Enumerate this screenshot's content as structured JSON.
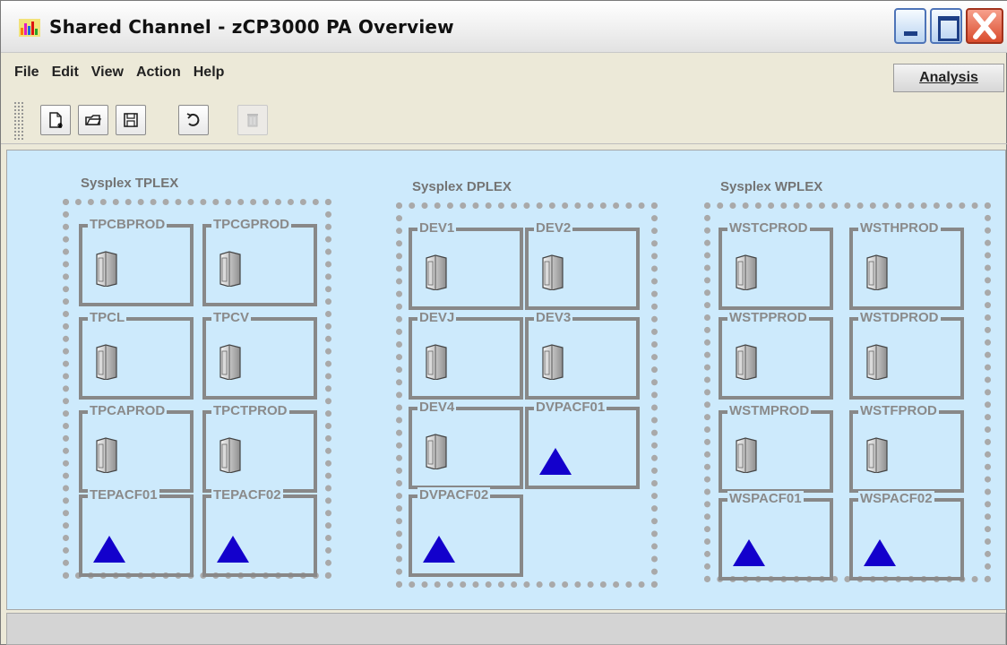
{
  "window": {
    "title": "Shared Channel - zCP3000 PA Overview"
  },
  "menu": {
    "file": "File",
    "edit": "Edit",
    "view": "View",
    "action": "Action",
    "help": "Help",
    "analysis": "Analysis"
  },
  "toolbar": {
    "icons": [
      "new-icon",
      "open-icon",
      "save-icon",
      "refresh-icon",
      "delete-icon"
    ]
  },
  "sysplexes": [
    {
      "label": "Sysplex TPLEX",
      "lpars": [
        {
          "name": "TPCBPROD",
          "type": "server"
        },
        {
          "name": "TPCGPROD",
          "type": "server"
        },
        {
          "name": "TPCL",
          "type": "server"
        },
        {
          "name": "TPCV",
          "type": "server"
        },
        {
          "name": "TPCAPROD",
          "type": "server"
        },
        {
          "name": "TPCTPROD",
          "type": "server"
        },
        {
          "name": "TEPACF01",
          "type": "coupling-facility"
        },
        {
          "name": "TEPACF02",
          "type": "coupling-facility"
        }
      ]
    },
    {
      "label": "Sysplex DPLEX",
      "lpars": [
        {
          "name": "DEV1",
          "type": "server"
        },
        {
          "name": "DEV2",
          "type": "server"
        },
        {
          "name": "DEVJ",
          "type": "server"
        },
        {
          "name": "DEV3",
          "type": "server"
        },
        {
          "name": "DEV4",
          "type": "server"
        },
        {
          "name": "DVPACF01",
          "type": "coupling-facility"
        },
        {
          "name": "DVPACF02",
          "type": "coupling-facility"
        }
      ]
    },
    {
      "label": "Sysplex WPLEX",
      "lpars": [
        {
          "name": "WSTCPROD",
          "type": "server"
        },
        {
          "name": "WSTHPROD",
          "type": "server"
        },
        {
          "name": "WSTPPROD",
          "type": "server"
        },
        {
          "name": "WSTDPROD",
          "type": "server"
        },
        {
          "name": "WSTMPROD",
          "type": "server"
        },
        {
          "name": "WSTFPROD",
          "type": "server"
        },
        {
          "name": "WSPACF01",
          "type": "coupling-facility"
        },
        {
          "name": "WSPACF02",
          "type": "coupling-facility"
        }
      ]
    }
  ],
  "colors": {
    "canvas_background": "#cdeafc",
    "lpar_border": "#888888",
    "label_gray": "#8a8a8a",
    "coupling_facility_blue": "#1300cc"
  }
}
